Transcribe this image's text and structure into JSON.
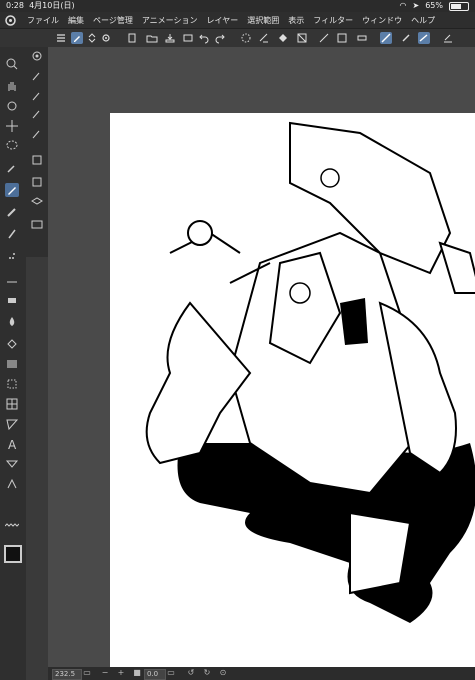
{
  "status": {
    "time": "0:28",
    "date": "4月10日(日)",
    "battery_percent": "65%",
    "battery_level": 0.65
  },
  "menu": [
    "ファイル",
    "編集",
    "ページ管理",
    "アニメーション",
    "レイヤー",
    "選択範囲",
    "表示",
    "フィルター",
    "ウィンドウ",
    "ヘルプ"
  ],
  "bottom": {
    "zoom": "232.5",
    "angle": "0.0"
  },
  "colors": {
    "accent": "#5b7ea8",
    "canvas": "#ffffff",
    "ink": "#000000",
    "chrome": "#2f2f2f"
  }
}
